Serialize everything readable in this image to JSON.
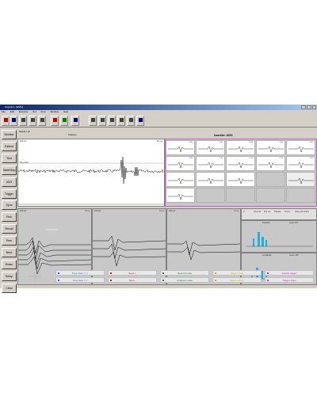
{
  "window": {
    "title": "Keypoint - [EMG]"
  },
  "menu": [
    "File",
    "Edit",
    "Examine",
    "Set",
    "Amp",
    "Window",
    "Help"
  ],
  "toolbar": {
    "buttons": [
      {
        "label": "",
        "icon": "exit-icon",
        "color": "#c00000"
      },
      {
        "label": "",
        "icon": "patient-icon",
        "color": "#000080"
      },
      {
        "label": "",
        "icon": "save-icon",
        "color": "#404040"
      },
      {
        "label": "",
        "icon": "print-icon",
        "color": "#404040"
      },
      {
        "label": "",
        "icon": "report-icon",
        "color": "#404040"
      },
      {
        "label": "",
        "icon": "stop-icon",
        "color": "#c00000"
      },
      {
        "label": "",
        "icon": "record-icon",
        "color": "#008000"
      },
      {
        "label": "",
        "icon": "stimulus-icon",
        "color": "#000080"
      },
      {
        "label": "",
        "icon": "setup-icon",
        "color": "#404040"
      },
      {
        "label": "",
        "icon": "timebase-icon",
        "color": "#404040"
      },
      {
        "label": "",
        "icon": "sensitivity-icon",
        "color": "#404040"
      },
      {
        "label": "",
        "icon": "filter-icon",
        "color": "#404040"
      },
      {
        "label": "",
        "icon": "trigger-icon",
        "color": "#404040"
      },
      {
        "label": "",
        "icon": "display-icon",
        "color": "#000080"
      }
    ]
  },
  "info": {
    "muscle_label": "Deltoid, Left",
    "trace_label": "Anatomy",
    "insertion": "Insertion: 15/15"
  },
  "sidebar": [
    "Monitor",
    "Patient",
    "Test",
    "Start/Stop",
    "AVG",
    "Trigger",
    "Sync",
    "Pick",
    "Recall",
    "Prev",
    "Next",
    "Erase",
    "Setup",
    "Clear"
  ],
  "top_trace": {
    "sens": "200 µV",
    "time": "10 ms",
    "level": "50 µV/div"
  },
  "mup_grid_labels": [
    "0.30",
    "0.30",
    "0.30",
    "0.30",
    "0.30",
    "0.30",
    "0.30",
    "0.30",
    "0.30",
    "0.30"
  ],
  "lower_panels": [
    {
      "left": "200 µV",
      "right": "5 ms"
    },
    {
      "left": "200 µV",
      "right": "5 ms"
    },
    {
      "left": "200 µV",
      "right": "5 ms"
    }
  ],
  "stats": {
    "columns": [
      "#",
      "Amp µV",
      "Dur ms",
      "Phases",
      "Turns",
      "Area µVms",
      "Size"
    ],
    "histogram1": {
      "title": "Duration",
      "summary": "mean 9.8"
    },
    "histogram2": {
      "title": "Amplitude",
      "summary": "mean 415"
    }
  },
  "bottom_buttons": {
    "row1": [
      {
        "label": "Time base <-->",
        "color": "#1f6fd0"
      },
      {
        "label": "Sens +",
        "color": "#d01818"
      },
      {
        "label": "Record mode",
        "color": "#208020"
      },
      {
        "label": "Show mode",
        "color": "#d0b000"
      },
      {
        "label": "Double trigger",
        "color": "#c020c0"
      }
    ],
    "row2": [
      {
        "label": "Time base >-<",
        "color": "#1f6fd0"
      },
      {
        "label": "Sens -",
        "color": "#d01818"
      },
      {
        "label": "Analysis mode",
        "color": "#208020"
      },
      {
        "label": "Pause results",
        "color": "#d0b000"
      },
      {
        "label": "Trigger slope",
        "color": "#c020c0"
      }
    ]
  }
}
